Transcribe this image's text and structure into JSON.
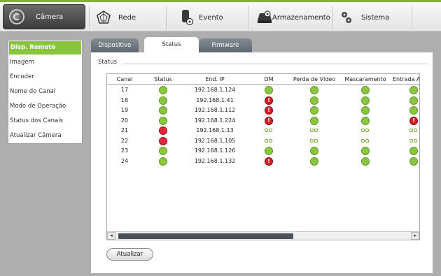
{
  "top_nav": {
    "tabs": [
      {
        "label": "Câmera",
        "icon": "camera-icon"
      },
      {
        "label": "Rede",
        "icon": "network-icon"
      },
      {
        "label": "Evento",
        "icon": "event-icon"
      },
      {
        "label": "Armazenamento",
        "icon": "storage-icon"
      },
      {
        "label": "Sistema",
        "icon": "gear-icon"
      }
    ],
    "accent_color": "#7fb33c"
  },
  "sidebar": {
    "items": [
      {
        "label": "Disp. Remoto"
      },
      {
        "label": "Imagem"
      },
      {
        "label": "Encoder"
      },
      {
        "label": "Nome do Canal"
      },
      {
        "label": "Modo de Operação"
      },
      {
        "label": "Status dos Canais"
      },
      {
        "label": "Atualizar Câmera"
      }
    ],
    "active_color": "#8ac43f"
  },
  "sub_tabs": [
    "Dispositivo",
    "Status",
    "Firmware"
  ],
  "panel": {
    "title": "Status",
    "columns": [
      "Canal",
      "Status",
      "End. IP",
      "DM",
      "Perda de Vídeo",
      "Mascaramento",
      "Entrada A"
    ],
    "rows": [
      {
        "canal": "17",
        "status": "green",
        "ip": "192.168.1.124",
        "dm": "green",
        "perda": "green",
        "masc": "green",
        "entrada": "green"
      },
      {
        "canal": "18",
        "status": "green",
        "ip": "192.168.1.41",
        "dm": "alert",
        "perda": "green",
        "masc": "green",
        "entrada": "green"
      },
      {
        "canal": "19",
        "status": "green",
        "ip": "192.168.1.112",
        "dm": "alert",
        "perda": "green",
        "masc": "green",
        "entrada": "green"
      },
      {
        "canal": "20",
        "status": "green",
        "ip": "192.168.1.224",
        "dm": "alert",
        "perda": "green",
        "masc": "green",
        "entrada": "alert"
      },
      {
        "canal": "21",
        "status": "red",
        "ip": "192.168.1.13",
        "dm": "link",
        "perda": "link",
        "masc": "link",
        "entrada": "link"
      },
      {
        "canal": "22",
        "status": "red",
        "ip": "192.168.1.105",
        "dm": "link",
        "perda": "link",
        "masc": "link",
        "entrada": "link"
      },
      {
        "canal": "23",
        "status": "green",
        "ip": "192.168.1.126",
        "dm": "green",
        "perda": "green",
        "masc": "green",
        "entrada": "green"
      },
      {
        "canal": "24",
        "status": "green",
        "ip": "192.168.1.132",
        "dm": "alert",
        "perda": "green",
        "masc": "green",
        "entrada": "green"
      }
    ],
    "refresh_label": "Atualizar"
  },
  "status_colors": {
    "ok": "#8cc63f",
    "offline": "#e0263a",
    "alert": "#d81c24"
  }
}
